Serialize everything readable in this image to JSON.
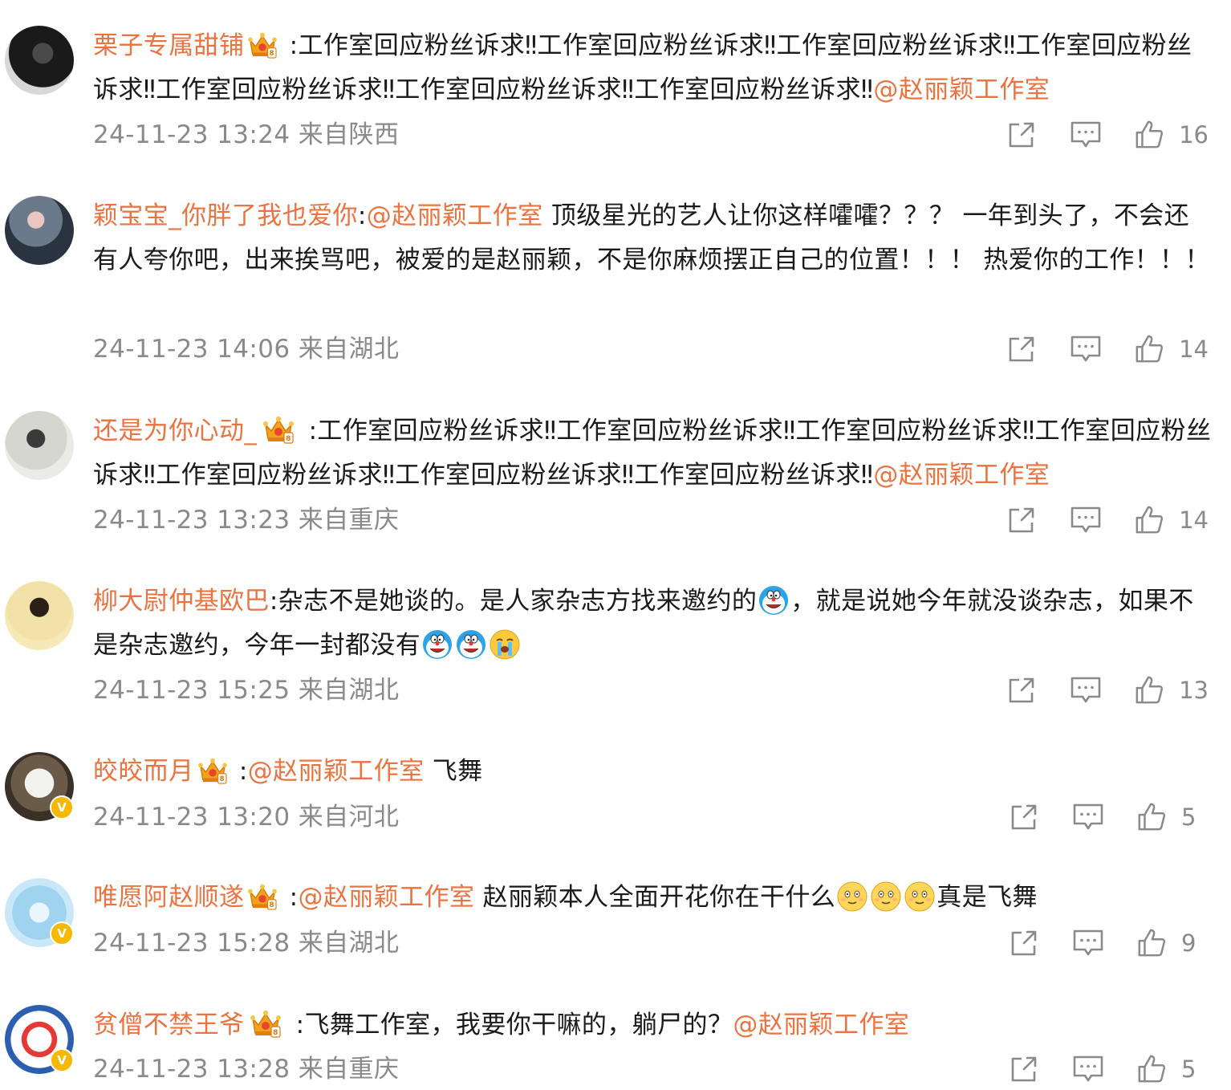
{
  "comments": [
    {
      "username": "栗子专属甜铺",
      "sep": " :",
      "body": "工作室回应粉丝诉求‼工作室回应粉丝诉求‼工作室回应粉丝诉求‼工作室回应粉丝诉求‼工作室回应粉丝诉求‼工作室回应粉丝诉求‼工作室回应粉丝诉求‼",
      "mention": "@赵丽颖工作室",
      "meta": "24-11-23 13:24 来自陕西",
      "likes": "16"
    },
    {
      "username": "颖宝宝_你胖了我也爱你",
      "sep": ":",
      "mention": "@赵丽颖工作室",
      "body": " 顶级星光的艺人让你这样嚯嚯？？？ 一年到头了，不会还有人夸你吧，出来挨骂吧，被爱的是赵丽颖，不是你麻烦摆正自己的位置！！！ 热爱你的工作！！！",
      "meta": "24-11-23 14:06 来自湖北",
      "likes": "14"
    },
    {
      "username": "还是为你心动_",
      "sep": " :",
      "body": "工作室回应粉丝诉求‼工作室回应粉丝诉求‼工作室回应粉丝诉求‼工作室回应粉丝诉求‼工作室回应粉丝诉求‼工作室回应粉丝诉求‼工作室回应粉丝诉求‼",
      "mention": "@赵丽颖工作室",
      "meta": "24-11-23 13:23 来自重庆",
      "likes": "14"
    },
    {
      "username": "柳大尉仲基欧巴",
      "sep": ":",
      "body_a": "杂志不是她谈的。是人家杂志方找来邀约的",
      "body_b": "，就是说她今年就没谈杂志，如果不是杂志邀约，今年一封都没有",
      "meta": "24-11-23 15:25 来自湖北",
      "likes": "13"
    },
    {
      "username": "皎皎而月",
      "sep": " :",
      "mention": "@赵丽颖工作室",
      "body": " 飞舞",
      "meta": "24-11-23 13:20 来自河北",
      "likes": "5"
    },
    {
      "username": "唯愿阿赵顺遂",
      "sep": " :",
      "mention": "@赵丽颖工作室",
      "body_a": " 赵丽颖本人全面开花你在干什么",
      "body_b": "真是飞舞",
      "meta": "24-11-23 15:28 来自湖北",
      "likes": "9"
    },
    {
      "username": "贫僧不禁王爷",
      "sep": " :",
      "body": "飞舞工作室，我要你干嘛的，躺尸的？",
      "mention": "@赵丽颖工作室",
      "meta": "24-11-23 13:28 来自重庆",
      "likes": "5"
    }
  ],
  "verified_badge": "V",
  "icons": {
    "share": "share-icon",
    "comment": "comment-icon",
    "like": "thumbs-up-icon",
    "crown": "crown-badge-icon",
    "doraemon": "doraemon-emoji",
    "crying": "crying-emoji",
    "awkward": "awkward-smile-emoji"
  },
  "colors": {
    "username": "#eb7340",
    "mention": "#eb7340",
    "text": "#1a1a1a",
    "meta": "#8a8a8a",
    "verified": "#f7b800"
  }
}
